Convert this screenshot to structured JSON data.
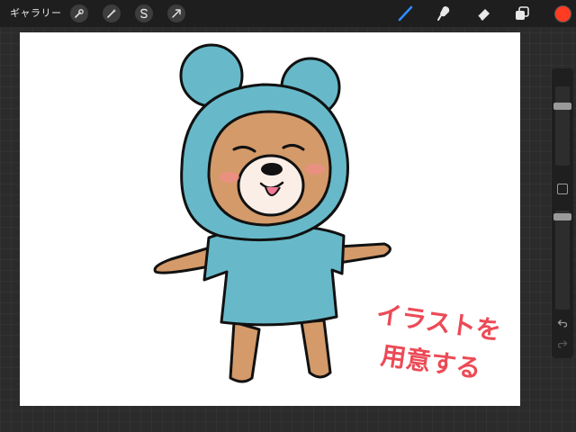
{
  "topbar": {
    "gallery_label": "ギャラリー",
    "left_tools": [
      "actions-wrench-icon",
      "adjustments-wand-icon",
      "selection-s-icon",
      "transform-arrow-icon"
    ],
    "right_tools": [
      "brush-icon",
      "smudge-icon",
      "eraser-icon",
      "layers-icon"
    ],
    "active_tool": "brush-icon",
    "brush_color": "#ff3b22",
    "accent_color": "#2f8cff"
  },
  "canvas": {
    "illustration": "bear-in-blue-hood",
    "text_line1": "イラストを",
    "text_line2": "用意する",
    "text_color": "#ec4a56",
    "hood_color": "#67b9c9",
    "fur_color": "#d49a6a"
  },
  "sidebar": {
    "brush_size_level": 0.23,
    "opacity_level": 0.03,
    "undo_icon": "undo-icon",
    "redo_icon": "redo-icon"
  }
}
